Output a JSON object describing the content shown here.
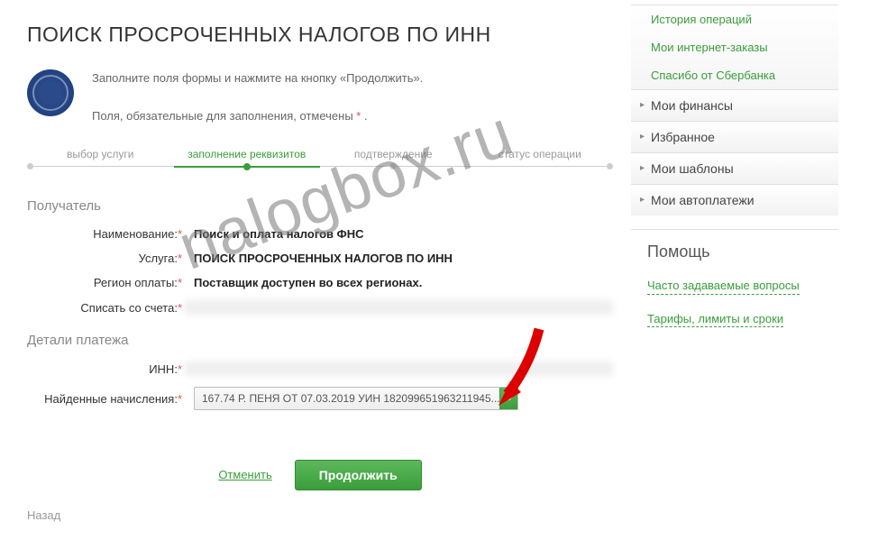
{
  "header": {
    "title": "ПОИСК ПРОСРОЧЕННЫХ НАЛОГОВ ПО ИНН"
  },
  "intro": {
    "line1": "Заполните поля формы и нажмите на кнопку «Продолжить».",
    "line2_pre": "Поля, обязательные для заполнения, отмечены ",
    "line2_post": " ."
  },
  "steps": [
    "выбор услуги",
    "заполнение реквизитов",
    "подтверждение",
    "статус операции"
  ],
  "active_step": 1,
  "sections": {
    "recipient": "Получатель",
    "details": "Детали платежа"
  },
  "fields": {
    "name_label": "Наименование:",
    "name_value": "Поиск и оплата налогов ФНС",
    "service_label": "Услуга:",
    "service_value": "ПОИСК ПРОСРОЧЕННЫХ НАЛОГОВ ПО ИНН",
    "region_label": "Регион оплаты:",
    "region_value": "Поставщик доступен во всех регионах.",
    "account_label": "Списать со счета:",
    "inn_label": "ИНН:",
    "found_label": "Найденные начисления:",
    "found_value": "167.74 Р. ПЕНЯ ОТ 07.03.2019 УИН 182099651963211945..."
  },
  "actions": {
    "cancel": "Отменить",
    "continue": "Продолжить",
    "back": "Назад"
  },
  "sidebar": {
    "links": [
      "История операций",
      "Мои интернет-заказы",
      "Спасибо от Сбербанка"
    ],
    "items": [
      "Мои финансы",
      "Избранное",
      "Мои шаблоны",
      "Мои автоплатежи"
    ],
    "help_title": "Помощь",
    "help_links": [
      "Часто задаваемые вопросы",
      "Тарифы, лимиты и сроки"
    ]
  },
  "watermark": "nalogbox.ru",
  "req_marker": "*"
}
